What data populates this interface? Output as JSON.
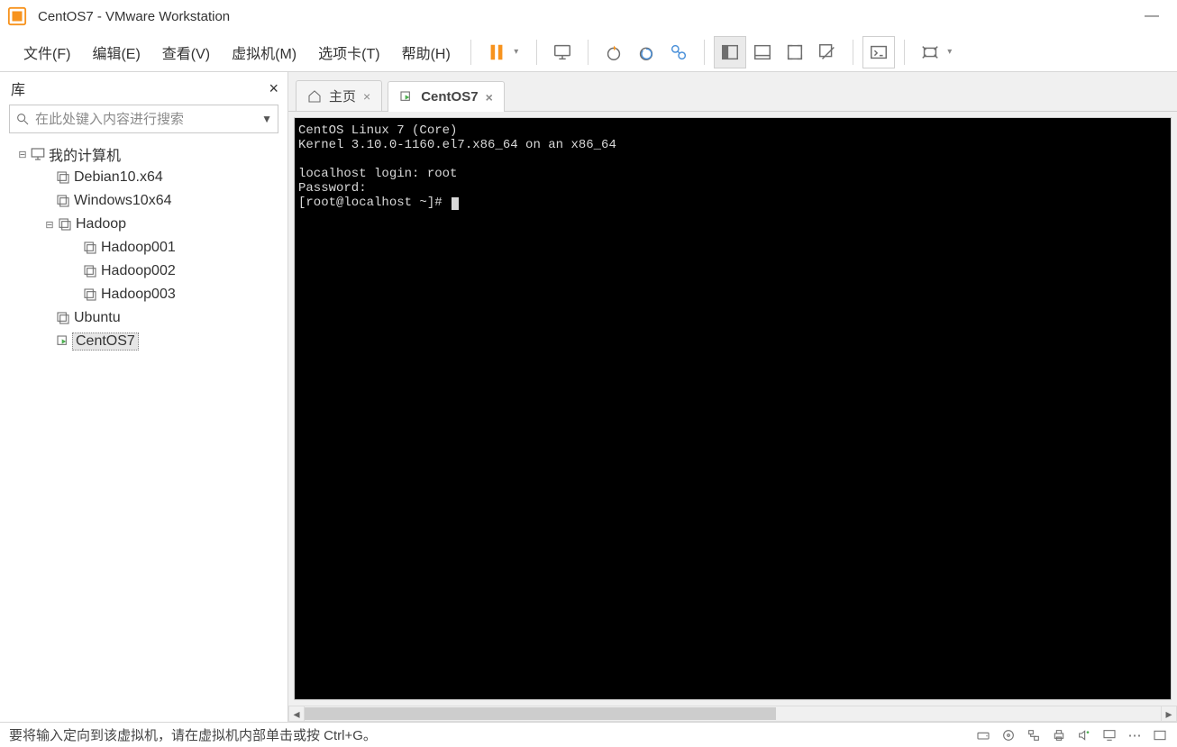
{
  "window": {
    "title": "CentOS7 - VMware Workstation"
  },
  "menu": {
    "file": "文件(F)",
    "edit": "编辑(E)",
    "view": "查看(V)",
    "vm": "虚拟机(M)",
    "tabs": "选项卡(T)",
    "help": "帮助(H)"
  },
  "sidebar": {
    "title": "库",
    "search_placeholder": "在此处键入内容进行搜索",
    "root": "我的计算机",
    "items": [
      {
        "label": "Debian10.x64"
      },
      {
        "label": "Windows10x64"
      },
      {
        "label": "Hadoop"
      },
      {
        "label": "Hadoop001"
      },
      {
        "label": "Hadoop002"
      },
      {
        "label": "Hadoop003"
      },
      {
        "label": "Ubuntu"
      },
      {
        "label": "CentOS7"
      }
    ]
  },
  "tabs": {
    "home": "主页",
    "vm": "CentOS7"
  },
  "terminal": {
    "line1": "CentOS Linux 7 (Core)",
    "line2": "Kernel 3.10.0-1160.el7.x86_64 on an x86_64",
    "line3": "",
    "line4": "localhost login: root",
    "line5": "Password:",
    "line6": "[root@localhost ~]# "
  },
  "status": {
    "hint": "要将输入定向到该虚拟机，请在虚拟机内部单击或按 Ctrl+G。"
  }
}
